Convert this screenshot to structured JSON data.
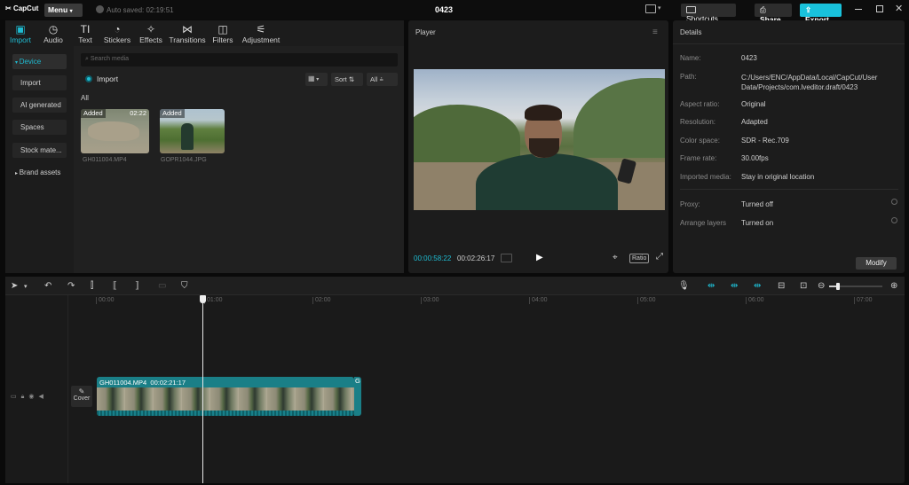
{
  "titlebar": {
    "app_name": "CapCut",
    "menu_label": "Menu",
    "autosave": "Auto saved: 02:19:51",
    "project_name": "0423",
    "shortcuts_label": "Shortcuts",
    "share_label": "Share",
    "export_label": "Export"
  },
  "tabs": [
    {
      "label": "Import",
      "icon": "import-icon"
    },
    {
      "label": "Audio",
      "icon": "audio-icon"
    },
    {
      "label": "Text",
      "icon": "text-icon"
    },
    {
      "label": "Stickers",
      "icon": "stickers-icon"
    },
    {
      "label": "Effects",
      "icon": "effects-icon"
    },
    {
      "label": "Transitions",
      "icon": "transitions-icon"
    },
    {
      "label": "Filters",
      "icon": "filters-icon"
    },
    {
      "label": "Adjustment",
      "icon": "adjustment-icon"
    }
  ],
  "sidebar": {
    "items": [
      "Device",
      "Import",
      "AI generated",
      "Spaces",
      "Stock mate...",
      "Brand assets"
    ]
  },
  "media": {
    "search_placeholder": "Search media",
    "import_label": "Import",
    "sort_label": "Sort",
    "filter_label": "All",
    "section_label": "All",
    "items": [
      {
        "badge": "Added",
        "duration": "02:22",
        "filename": "GH011004.MP4"
      },
      {
        "badge": "Added",
        "duration": "",
        "filename": "GOPR1044.JPG"
      }
    ]
  },
  "player": {
    "title": "Player",
    "current_time": "00:00:58:22",
    "total_time": "00:02:26:17",
    "ratio_label": "Ratio"
  },
  "details": {
    "title": "Details",
    "rows": [
      {
        "k": "Name:",
        "v": "0423"
      },
      {
        "k": "Path:",
        "v": "C:/Users/ENC/AppData/Local/CapCut/User Data/Projects/com.lveditor.draft/0423"
      },
      {
        "k": "Aspect ratio:",
        "v": "Original"
      },
      {
        "k": "Resolution:",
        "v": "Adapted"
      },
      {
        "k": "Color space:",
        "v": "SDR - Rec.709"
      },
      {
        "k": "Frame rate:",
        "v": "30.00fps"
      },
      {
        "k": "Imported media:",
        "v": "Stay in original location"
      },
      {
        "k": "Proxy:",
        "v": "Turned off"
      },
      {
        "k": "Arrange layers",
        "v": "Turned on"
      }
    ],
    "modify_label": "Modify"
  },
  "timeline": {
    "ruler": [
      "00:00",
      "01:00",
      "02:00",
      "03:00",
      "04:00",
      "05:00",
      "06:00",
      "07:00"
    ],
    "clip_label": "GH011004.MP4",
    "clip_duration": "00:02:21:17",
    "cover_label": "Cover",
    "clip_tail": "G"
  },
  "colors": {
    "accent": "#1fbcd2",
    "export": "#19c2dc",
    "clip": "#1a7f87"
  }
}
